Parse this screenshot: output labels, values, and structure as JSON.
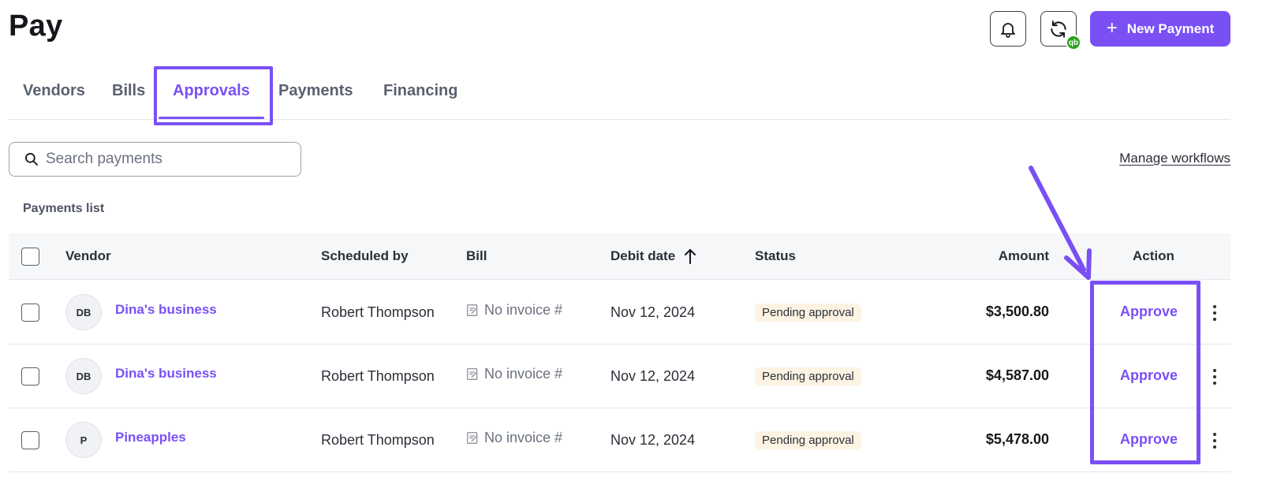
{
  "header": {
    "title": "Pay",
    "new_payment_label": "New Payment",
    "sync_badge": "qb"
  },
  "tabs": [
    {
      "label": "Vendors",
      "active": false
    },
    {
      "label": "Bills",
      "active": false
    },
    {
      "label": "Approvals",
      "active": true
    },
    {
      "label": "Payments",
      "active": false
    },
    {
      "label": "Financing",
      "active": false
    }
  ],
  "search": {
    "placeholder": "Search payments",
    "value": ""
  },
  "manage_workflows_label": "Manage workflows",
  "list_label": "Payments list",
  "table": {
    "columns": [
      "Vendor",
      "Scheduled by",
      "Bill",
      "Debit date",
      "Status",
      "Amount",
      "Action"
    ],
    "sort_indicator": "ascending",
    "rows": [
      {
        "initials": "DB",
        "vendor": "Dina's business",
        "scheduled_by": "Robert Thompson",
        "bill": "No invoice #",
        "debit_date": "Nov 12, 2024",
        "status": "Pending approval",
        "amount": "$3,500.80",
        "action": "Approve"
      },
      {
        "initials": "DB",
        "vendor": "Dina's business",
        "scheduled_by": "Robert Thompson",
        "bill": "No invoice #",
        "debit_date": "Nov 12, 2024",
        "status": "Pending approval",
        "amount": "$4,587.00",
        "action": "Approve"
      },
      {
        "initials": "P",
        "vendor": "Pineapples",
        "scheduled_by": "Robert Thompson",
        "bill": "No invoice #",
        "debit_date": "Nov 12, 2024",
        "status": "Pending approval",
        "amount": "$5,478.00",
        "action": "Approve"
      }
    ]
  },
  "colors": {
    "accent": "#7a50f5",
    "status_badge_bg": "#fdf3e3",
    "qb_green": "#2ca01c"
  }
}
